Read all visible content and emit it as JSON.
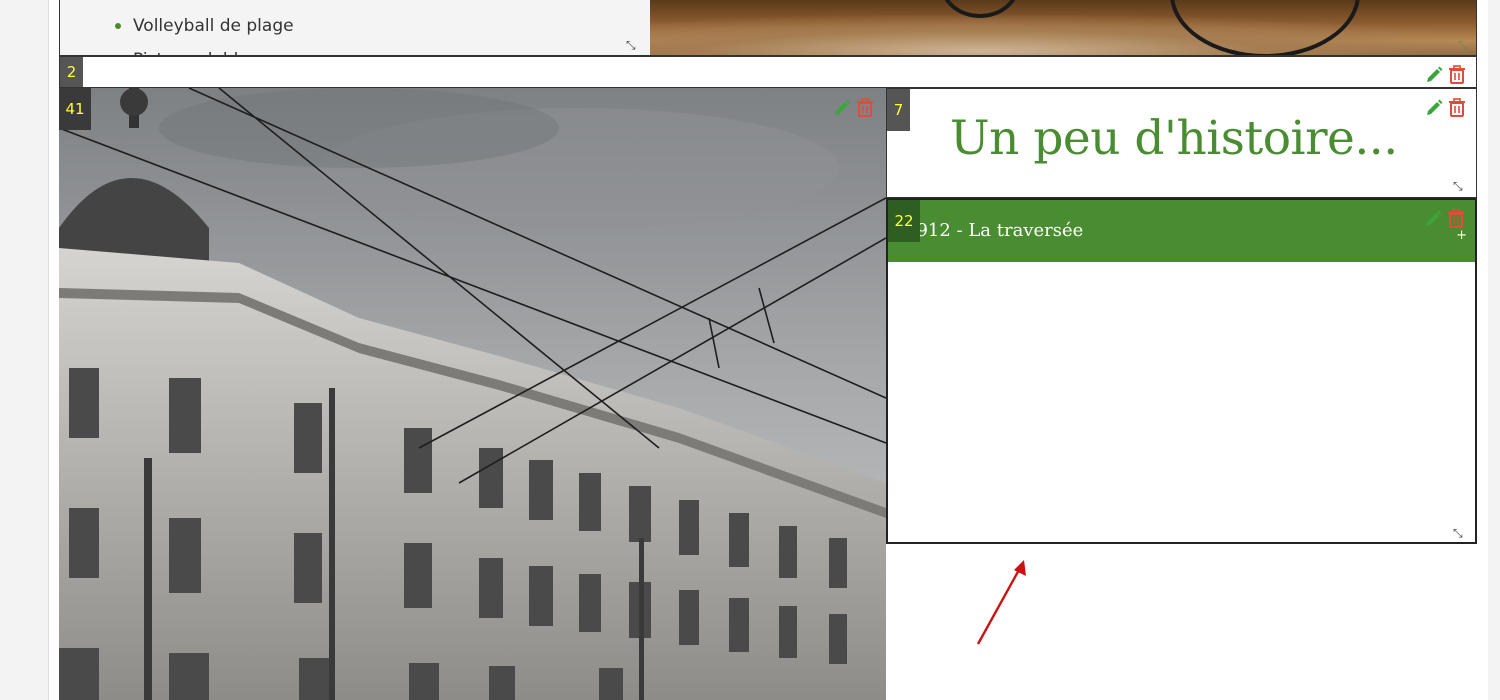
{
  "top_block": {
    "list_items": [
      "Volleyball de plage",
      "Piste cyclable"
    ]
  },
  "rows": {
    "row2_badge": "2"
  },
  "photo_block": {
    "badge": "41",
    "image_alt": "Black and white photograph of an ornate historic building with tram wires"
  },
  "heading_block": {
    "badge": "7",
    "title": "Un peu d'histoire..."
  },
  "accordion_block": {
    "badge": "22",
    "item_title": "1912 - La traversée",
    "expand_symbol": "+"
  },
  "icons": {
    "edit": "pencil-icon",
    "delete": "trash-icon",
    "resize": "resize-handle-icon"
  },
  "colors": {
    "accent_green": "#4a8c32",
    "edit_green": "#3aa63a",
    "delete_red": "#e04b3a",
    "badge_text": "#ffff33",
    "arrow_red": "#cc1111"
  }
}
